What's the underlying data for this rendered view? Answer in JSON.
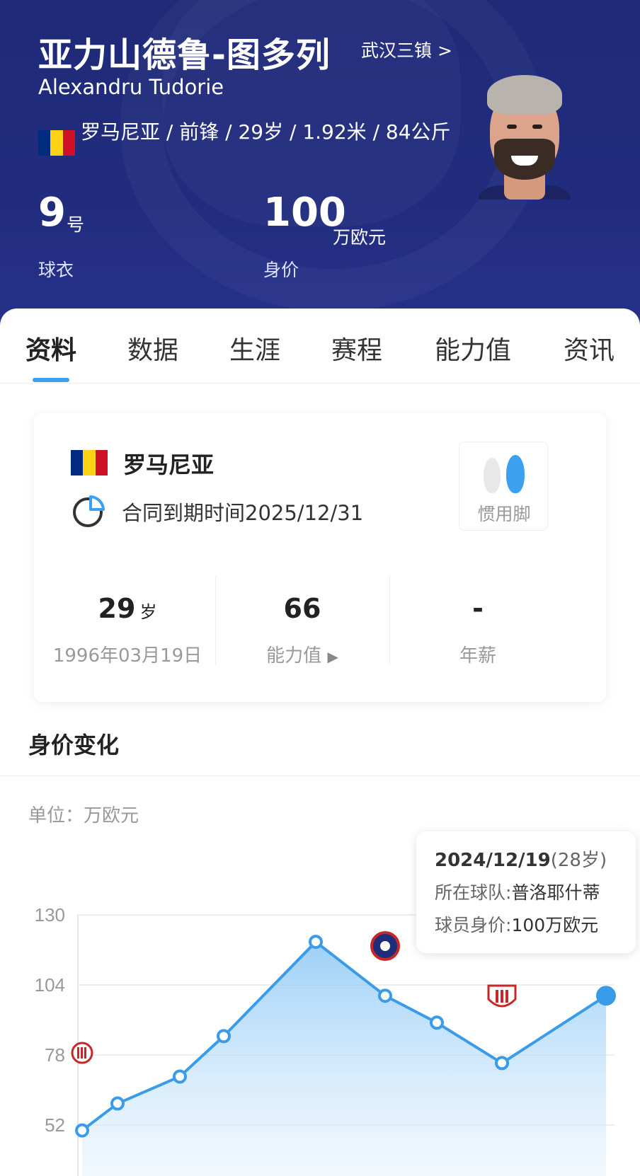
{
  "header": {
    "name_cn": "亚力山德鲁-图多列",
    "team_link": "武汉三镇 >",
    "name_en": "Alexandru Tudorie",
    "bio": "罗马尼亚 / 前锋 / 29岁 / 1.92米 / 84公斤",
    "jersey_number": "9",
    "jersey_unit": "号",
    "jersey_label": "球衣",
    "market_value": "100",
    "market_value_unit": "万欧元",
    "market_value_label": "身价"
  },
  "tabs": [
    "资料",
    "数据",
    "生涯",
    "赛程",
    "能力值",
    "资讯"
  ],
  "info_card": {
    "country": "罗马尼亚",
    "contract": "合同到期时间2025/12/31",
    "preferred_foot_label": "惯用脚",
    "age_value": "29",
    "age_unit": "岁",
    "birthdate": "1996年03月19日",
    "rating_value": "66",
    "rating_label": "能力值",
    "salary_value": "-",
    "salary_label": "年薪"
  },
  "value_section": {
    "title": "身价变化",
    "unit_label": "单位：万欧元"
  },
  "tooltip": {
    "date": "2024/12/19",
    "age": "(28岁)",
    "team_label": "所在球队:",
    "team": "普洛耶什蒂",
    "value_label": "球员身价:",
    "value": "100万欧元"
  },
  "colors": {
    "header_bg": "#212c7e",
    "accent": "#3aa0ef",
    "line": "#3a9be8"
  },
  "chart_data": {
    "type": "area",
    "ylim": [
      0,
      130
    ],
    "yticks": [
      26,
      52,
      78,
      104,
      130
    ],
    "values": [
      50,
      60,
      70,
      85,
      120,
      100,
      90,
      75,
      100
    ],
    "xlabel": "",
    "ylabel": ""
  }
}
